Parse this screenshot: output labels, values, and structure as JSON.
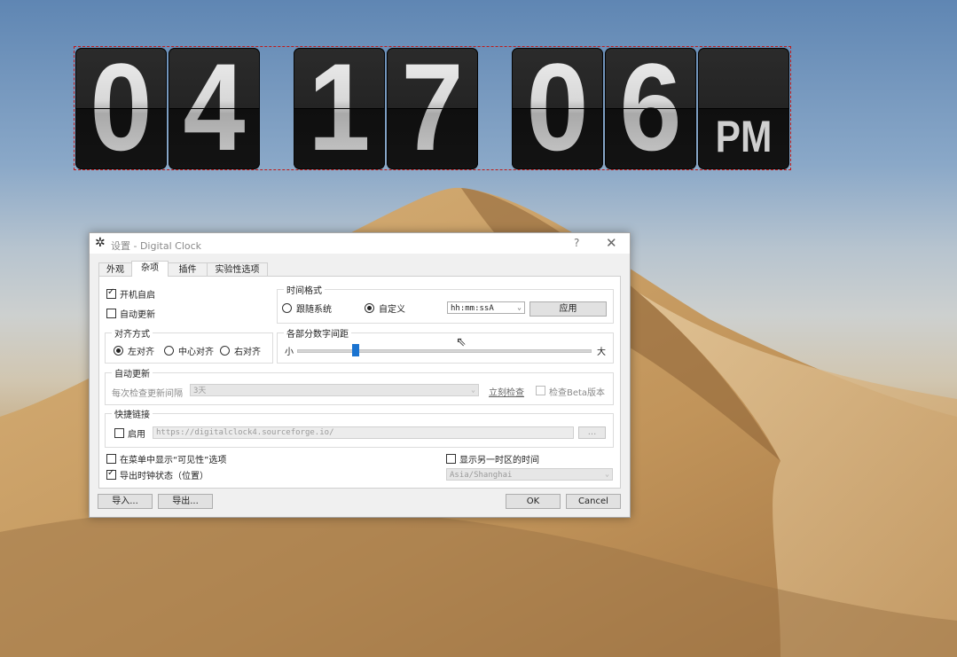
{
  "clock": {
    "hours": [
      "0",
      "4"
    ],
    "minutes": [
      "1",
      "7"
    ],
    "seconds": [
      "0",
      "6"
    ],
    "ampm": "PM"
  },
  "dialog": {
    "title": "设置 - Digital Clock",
    "help": "?",
    "close": "✕",
    "tabs": [
      "外观",
      "杂项",
      "插件",
      "实验性选项"
    ],
    "active_tab": "杂项",
    "autostart": {
      "label": "开机自启",
      "checked": true
    },
    "autoupdate": {
      "label": "自动更新",
      "checked": false
    },
    "time_format": {
      "legend": "时间格式",
      "follow_system": "跟随系统",
      "custom": "自定义",
      "format_value": "hh:mm:ssA",
      "apply": "应用"
    },
    "alignment": {
      "legend": "对齐方式",
      "left": "左对齐",
      "center": "中心对齐",
      "right": "右对齐",
      "selected": "左对齐"
    },
    "spacing": {
      "legend": "各部分数字间距",
      "min_label": "小",
      "max_label": "大",
      "value_fraction": 0.2
    },
    "update": {
      "legend": "自动更新",
      "interval_label": "每次检查更新间隔",
      "interval_value": "3天",
      "check_now": "立刻检查",
      "beta": "检查Beta版本"
    },
    "quicklink": {
      "legend": "快捷链接",
      "enable": "启用",
      "url": "https://digitalclock4.sourceforge.io/",
      "browse": "..."
    },
    "show_visibility": "在菜单中显示“可见性”选项",
    "export_state": "导出时钟状态（位置）",
    "other_tz": "显示另一时区的时间",
    "timezone": "Asia/Shanghai",
    "import": "导入...",
    "export": "导出...",
    "ok": "OK",
    "cancel": "Cancel"
  }
}
